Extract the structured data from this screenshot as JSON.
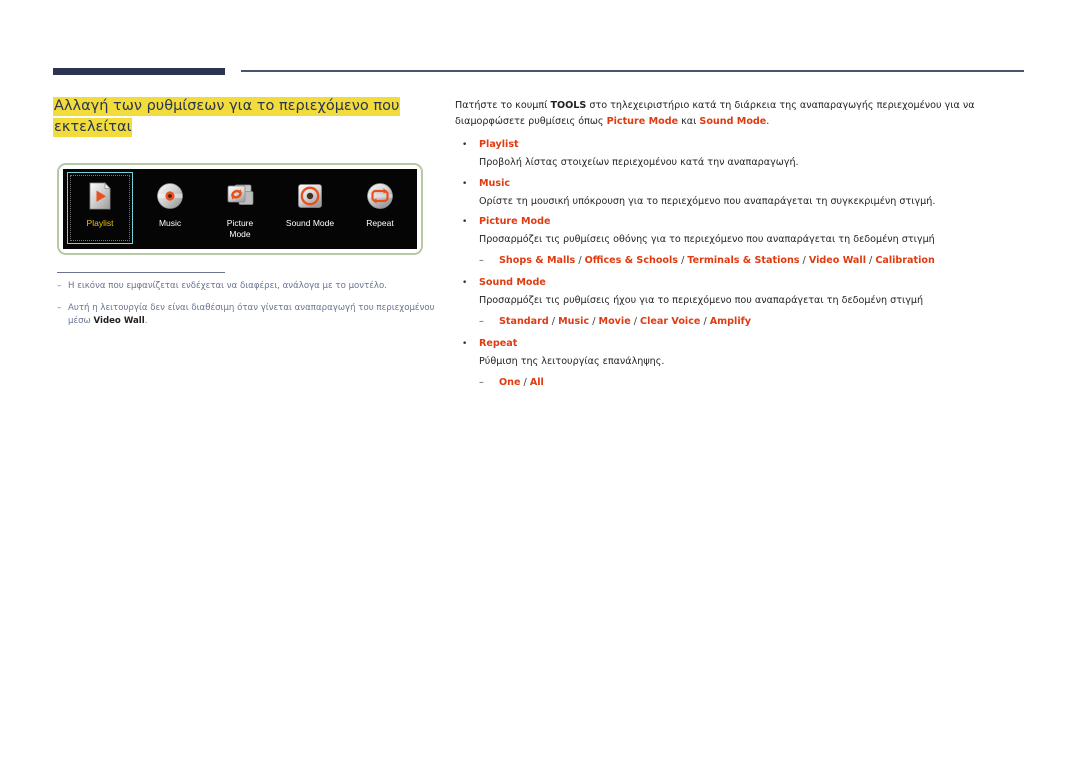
{
  "page": {
    "title_line1": "Αλλαγή των ρυθμίσεων για το περιεχόμενο που",
    "title_line2": "εκτελείται",
    "highlight_color": "#f2dc3c",
    "accent_color": "#e03a10",
    "rule_color": "#2b3550"
  },
  "device_panel": {
    "tiles": [
      {
        "icon": "playlist-file-play-icon",
        "label": "Playlist",
        "selected": true
      },
      {
        "icon": "music-disc-icon",
        "label": "Music",
        "selected": false
      },
      {
        "icon": "picture-mode-refresh-icon",
        "label": "Picture",
        "label2": "Mode",
        "selected": false
      },
      {
        "icon": "sound-mode-speaker-icon",
        "label": "Sound Mode",
        "selected": false
      },
      {
        "icon": "repeat-loop-icon",
        "label": "Repeat",
        "selected": false
      }
    ]
  },
  "footnotes": [
    {
      "marker": "–",
      "text": "Η εικόνα που εμφανίζεται ενδέχεται να διαφέρει, ανάλογα με το μοντέλο."
    },
    {
      "marker": "–",
      "text_before": "Αυτή η λειτουργία δεν είναι διαθέσιμη όταν γίνεται αναπαραγωγή του περιεχομένου μέσω ",
      "bold": "Video Wall",
      "text_after": "."
    }
  ],
  "content": {
    "intro": {
      "part1": "Πατήστε το κουμπί ",
      "bold1": "TOOLS",
      "part2": " στο τηλεχειριστήριο κατά τη διάρκεια της αναπαραγωγής περιεχομένου για να διαμορφώσετε ρυθμίσεις όπως ",
      "red1": "Picture Mode",
      "part3": " και ",
      "red2": "Sound Mode",
      "part4": "."
    },
    "bullets": [
      {
        "marker": "•",
        "label": "Playlist",
        "desc": "Προβολή λίστας στοιχείων περιεχομένου κατά την αναπαραγωγή.",
        "sub_marker": "",
        "options": []
      },
      {
        "marker": "•",
        "label": "Music",
        "desc": "Ορίστε τη μουσική υπόκρουση για το περιεχόμενο που αναπαράγεται τη συγκεκριμένη στιγμή.",
        "sub_marker": "",
        "options": []
      },
      {
        "marker": "•",
        "label": "Picture Mode",
        "desc": "Προσαρμόζει τις ρυθμίσεις οθόνης για το περιεχόμενο που αναπαράγεται τη δεδομένη στιγμή",
        "sub_marker": "–",
        "options": [
          "Shops & Malls",
          "Offices & Schools",
          "Terminals & Stations",
          "Video Wall",
          "Calibration"
        ]
      },
      {
        "marker": "•",
        "label": "Sound Mode",
        "desc": "Προσαρμόζει τις ρυθμίσεις ήχου για το περιεχόμενο που αναπαράγεται τη δεδομένη στιγμή",
        "sub_marker": "–",
        "options": [
          "Standard",
          "Music",
          "Movie",
          "Clear Voice",
          "Amplify"
        ]
      },
      {
        "marker": "•",
        "label": "Repeat",
        "desc": "Ρύθμιση της λειτουργίας επανάληψης.",
        "sub_marker": "–",
        "options": [
          "One",
          "All"
        ]
      }
    ]
  }
}
